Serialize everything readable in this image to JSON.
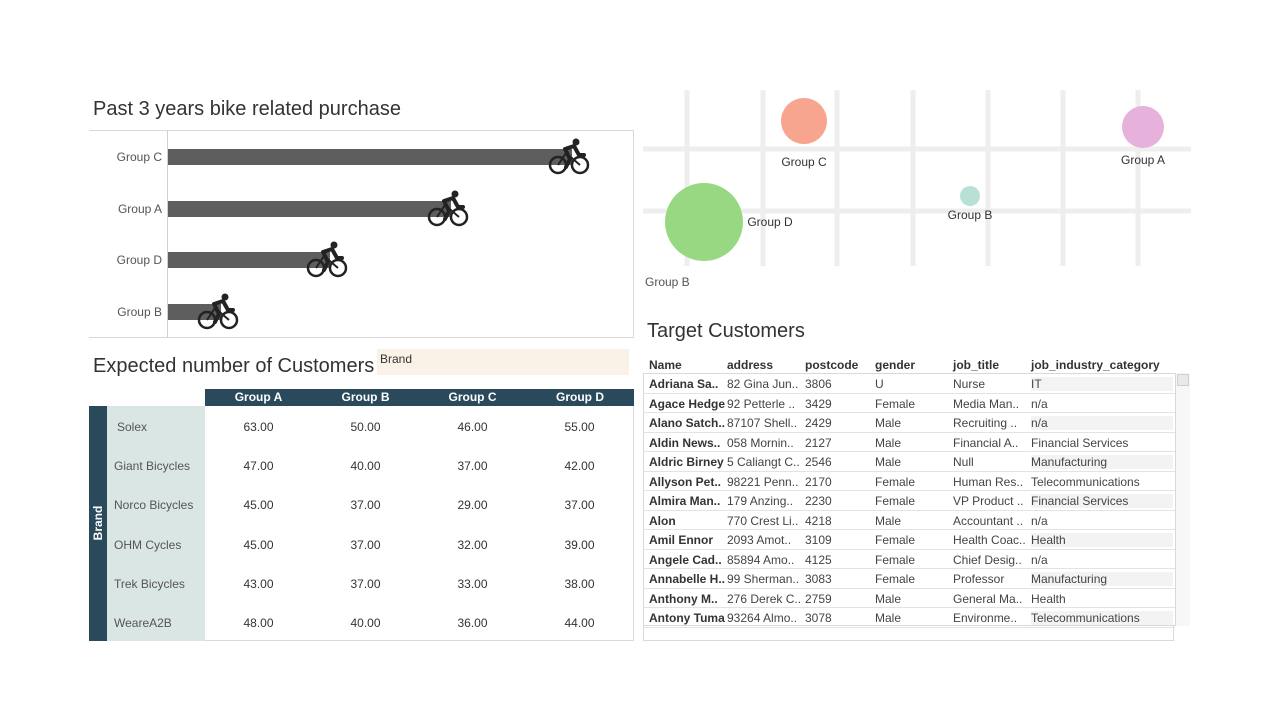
{
  "bar_section": {
    "title": "Past 3 years bike related purchase",
    "chart_data": {
      "type": "bar",
      "categories": [
        "Group C",
        "Group A",
        "Group D",
        "Group B"
      ],
      "values": [
        100,
        70,
        40,
        13
      ]
    }
  },
  "bubble_section": {
    "bottom_label": "Group B",
    "chart_data": {
      "type": "scatter",
      "points": [
        {
          "name": "Group C",
          "color": "#f8a58f",
          "size": 0.6
        },
        {
          "name": "Group A",
          "color": "#e6b1db",
          "size": 0.55
        },
        {
          "name": "Group D",
          "color": "#98d883",
          "size": 1.0
        },
        {
          "name": "Group B",
          "color": "#b9e0d6",
          "size": 0.25
        }
      ]
    }
  },
  "customers_section": {
    "title": "Expected number of Customers",
    "filter_label": "Brand",
    "side_label": "Brand",
    "columns": [
      "Group A",
      "Group B",
      "Group C",
      "Group D"
    ],
    "rows": [
      {
        "brand": "Solex",
        "values": [
          "63.00",
          "50.00",
          "46.00",
          "55.00"
        ]
      },
      {
        "brand": "Giant Bicycles",
        "values": [
          "47.00",
          "40.00",
          "37.00",
          "42.00"
        ]
      },
      {
        "brand": "Norco Bicycles",
        "values": [
          "45.00",
          "37.00",
          "29.00",
          "37.00"
        ]
      },
      {
        "brand": "OHM Cycles",
        "values": [
          "45.00",
          "37.00",
          "32.00",
          "39.00"
        ]
      },
      {
        "brand": "Trek Bicycles",
        "values": [
          "43.00",
          "37.00",
          "33.00",
          "38.00"
        ]
      },
      {
        "brand": "WeareA2B",
        "values": [
          "48.00",
          "40.00",
          "36.00",
          "44.00"
        ]
      }
    ]
  },
  "target_section": {
    "title": "Target Customers",
    "columns": [
      "Name",
      "address",
      "postcode",
      "gender",
      "job_title",
      "job_industry_category"
    ],
    "rows": [
      [
        "Adriana Sa..",
        "82 Gina Jun..",
        "3806",
        "U",
        "Nurse",
        "IT"
      ],
      [
        "Agace Hedge",
        "92 Petterle ..",
        "3429",
        "Female",
        "Media Man..",
        "n/a"
      ],
      [
        "Alano Satch..",
        "87107 Shell..",
        "2429",
        "Male",
        "Recruiting ..",
        "n/a"
      ],
      [
        "Aldin News..",
        "058 Mornin..",
        "2127",
        "Male",
        "Financial A..",
        "Financial Services"
      ],
      [
        "Aldric Birney",
        "5 Caliangt C..",
        "2546",
        "Male",
        "Null",
        "Manufacturing"
      ],
      [
        "Allyson Pet..",
        "98221 Penn..",
        "2170",
        "Female",
        "Human Res..",
        "Telecommunications"
      ],
      [
        "Almira Man..",
        "179 Anzing..",
        "2230",
        "Female",
        "VP Product ..",
        "Financial Services"
      ],
      [
        "Alon",
        "770 Crest Li..",
        "4218",
        "Male",
        "Accountant ..",
        "n/a"
      ],
      [
        "Amil Ennor",
        "2093 Amot..",
        "3109",
        "Female",
        "Health Coac..",
        "Health"
      ],
      [
        "Angele Cad..",
        "85894 Amo..",
        "4125",
        "Female",
        "Chief Desig..",
        "n/a"
      ],
      [
        "Annabelle H..",
        "99 Sherman..",
        "3083",
        "Female",
        "Professor",
        "Manufacturing"
      ],
      [
        "Anthony M..",
        "276 Derek C..",
        "2759",
        "Male",
        "General Ma..",
        "Health"
      ],
      [
        "Antony Tuma",
        "93264 Almo..",
        "3078",
        "Male",
        "Environme..",
        "Telecommunications"
      ]
    ]
  }
}
